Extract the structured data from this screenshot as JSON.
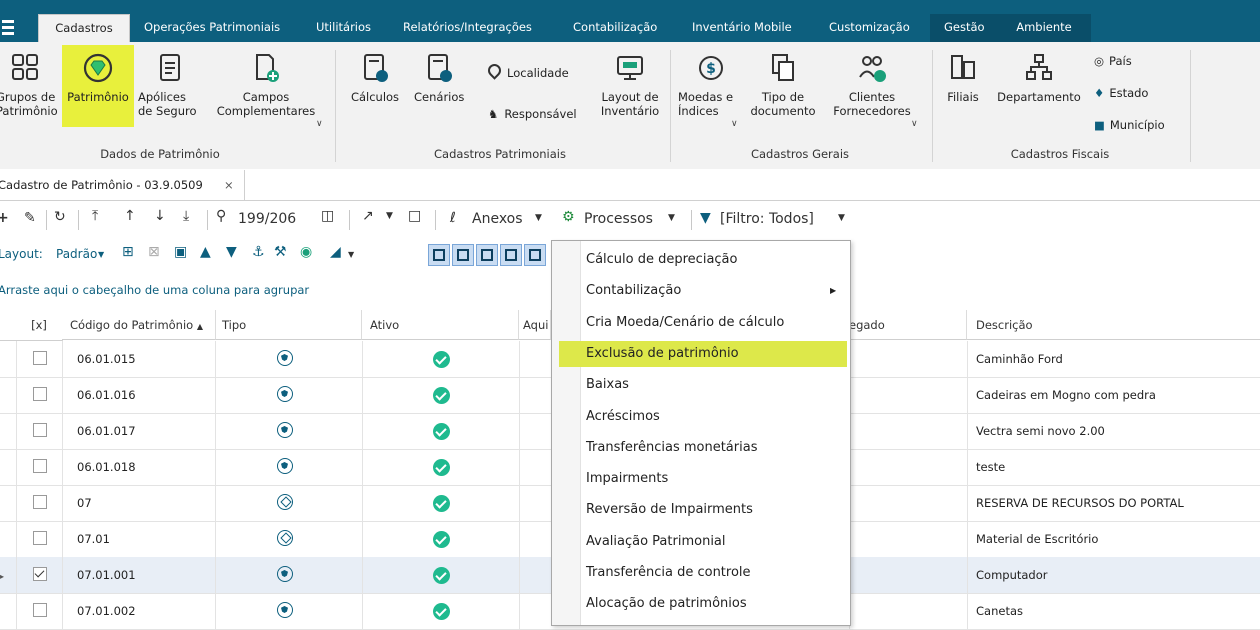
{
  "menubar": {
    "tabs": [
      "Cadastros",
      "Operações Patrimoniais",
      "Utilitários",
      "Relatórios/Integrações",
      "Contabilização",
      "Inventário Mobile",
      "Customização",
      "Gestão",
      "Ambiente"
    ]
  },
  "ribbon": {
    "grupos_patrimonio": "Grupos de\nPatrimônio",
    "patrimonio": "Patrimônio",
    "apolices": "Apólices\nde Seguro",
    "campos": "Campos\nComplementares",
    "calculos": "Cálculos",
    "cenarios": "Cenários",
    "localidade": "Localidade",
    "responsavel": "Responsável",
    "layout_inventario": "Layout de\nInventário",
    "moedas": "Moedas e\nÍndices",
    "tipo_documento": "Tipo de\ndocumento",
    "clientes": "Clientes\nFornecedores",
    "filiais": "Filiais",
    "departamento": "Departamento",
    "pais": "País",
    "estado": "Estado",
    "municipio": "Município",
    "groups": [
      "Dados de Patrimônio",
      "Cadastros Patrimoniais",
      "Cadastros Gerais",
      "Cadastros Fiscais"
    ],
    "highlight_color": "#e8f03c"
  },
  "doctab": {
    "label": "Cadastro de Patrimônio - 03.9.0509",
    "close": "×"
  },
  "toolbar": {
    "counter": "199/206",
    "anexos": "Anexos",
    "processos": "Processos",
    "filtro": "[Filtro: Todos]",
    "layout_label": "Layout:",
    "layout_value": "Padrão"
  },
  "groupbar": {
    "hint": "Arraste aqui o cabeçalho de uma coluna para agrupar"
  },
  "grid": {
    "headers": {
      "check": "[x]",
      "codigo": "Código do Patrimônio",
      "tipo": "Tipo",
      "ativo": "Ativo",
      "aqui": "Aqui",
      "agregado": "egado",
      "descricao": "Descrição"
    },
    "rows": [
      {
        "codigo": "06.01.015",
        "tipo": "shield",
        "checked": false,
        "descricao": "Caminhão Ford"
      },
      {
        "codigo": "06.01.016",
        "tipo": "shield",
        "checked": false,
        "descricao": "Cadeiras em Mogno com pedra"
      },
      {
        "codigo": "06.01.017",
        "tipo": "shield",
        "checked": false,
        "descricao": "Vectra semi novo 2.00"
      },
      {
        "codigo": "06.01.018",
        "tipo": "shield",
        "checked": false,
        "descricao": "teste"
      },
      {
        "codigo": "07",
        "tipo": "tag",
        "checked": false,
        "descricao": "RESERVA DE RECURSOS DO PORTAL"
      },
      {
        "codigo": "07.01",
        "tipo": "tag",
        "checked": false,
        "descricao": "Material de Escritório"
      },
      {
        "codigo": "07.01.001",
        "tipo": "shield",
        "checked": true,
        "descricao": "Computador"
      },
      {
        "codigo": "07.01.002",
        "tipo": "shield",
        "checked": false,
        "descricao": "Canetas"
      }
    ]
  },
  "processos_menu": {
    "items": [
      "Cálculo de depreciação",
      "Contabilização",
      "Cria Moeda/Cenário de cálculo",
      "Exclusão de patrimônio",
      "Baixas",
      "Acréscimos",
      "Transferências monetárias",
      "Impairments",
      "Reversão de Impairments",
      "Avaliação Patrimonial",
      "Transferência de controle",
      "Alocação de patrimônios"
    ],
    "highlighted_index": 3,
    "submenu_index": 1
  }
}
